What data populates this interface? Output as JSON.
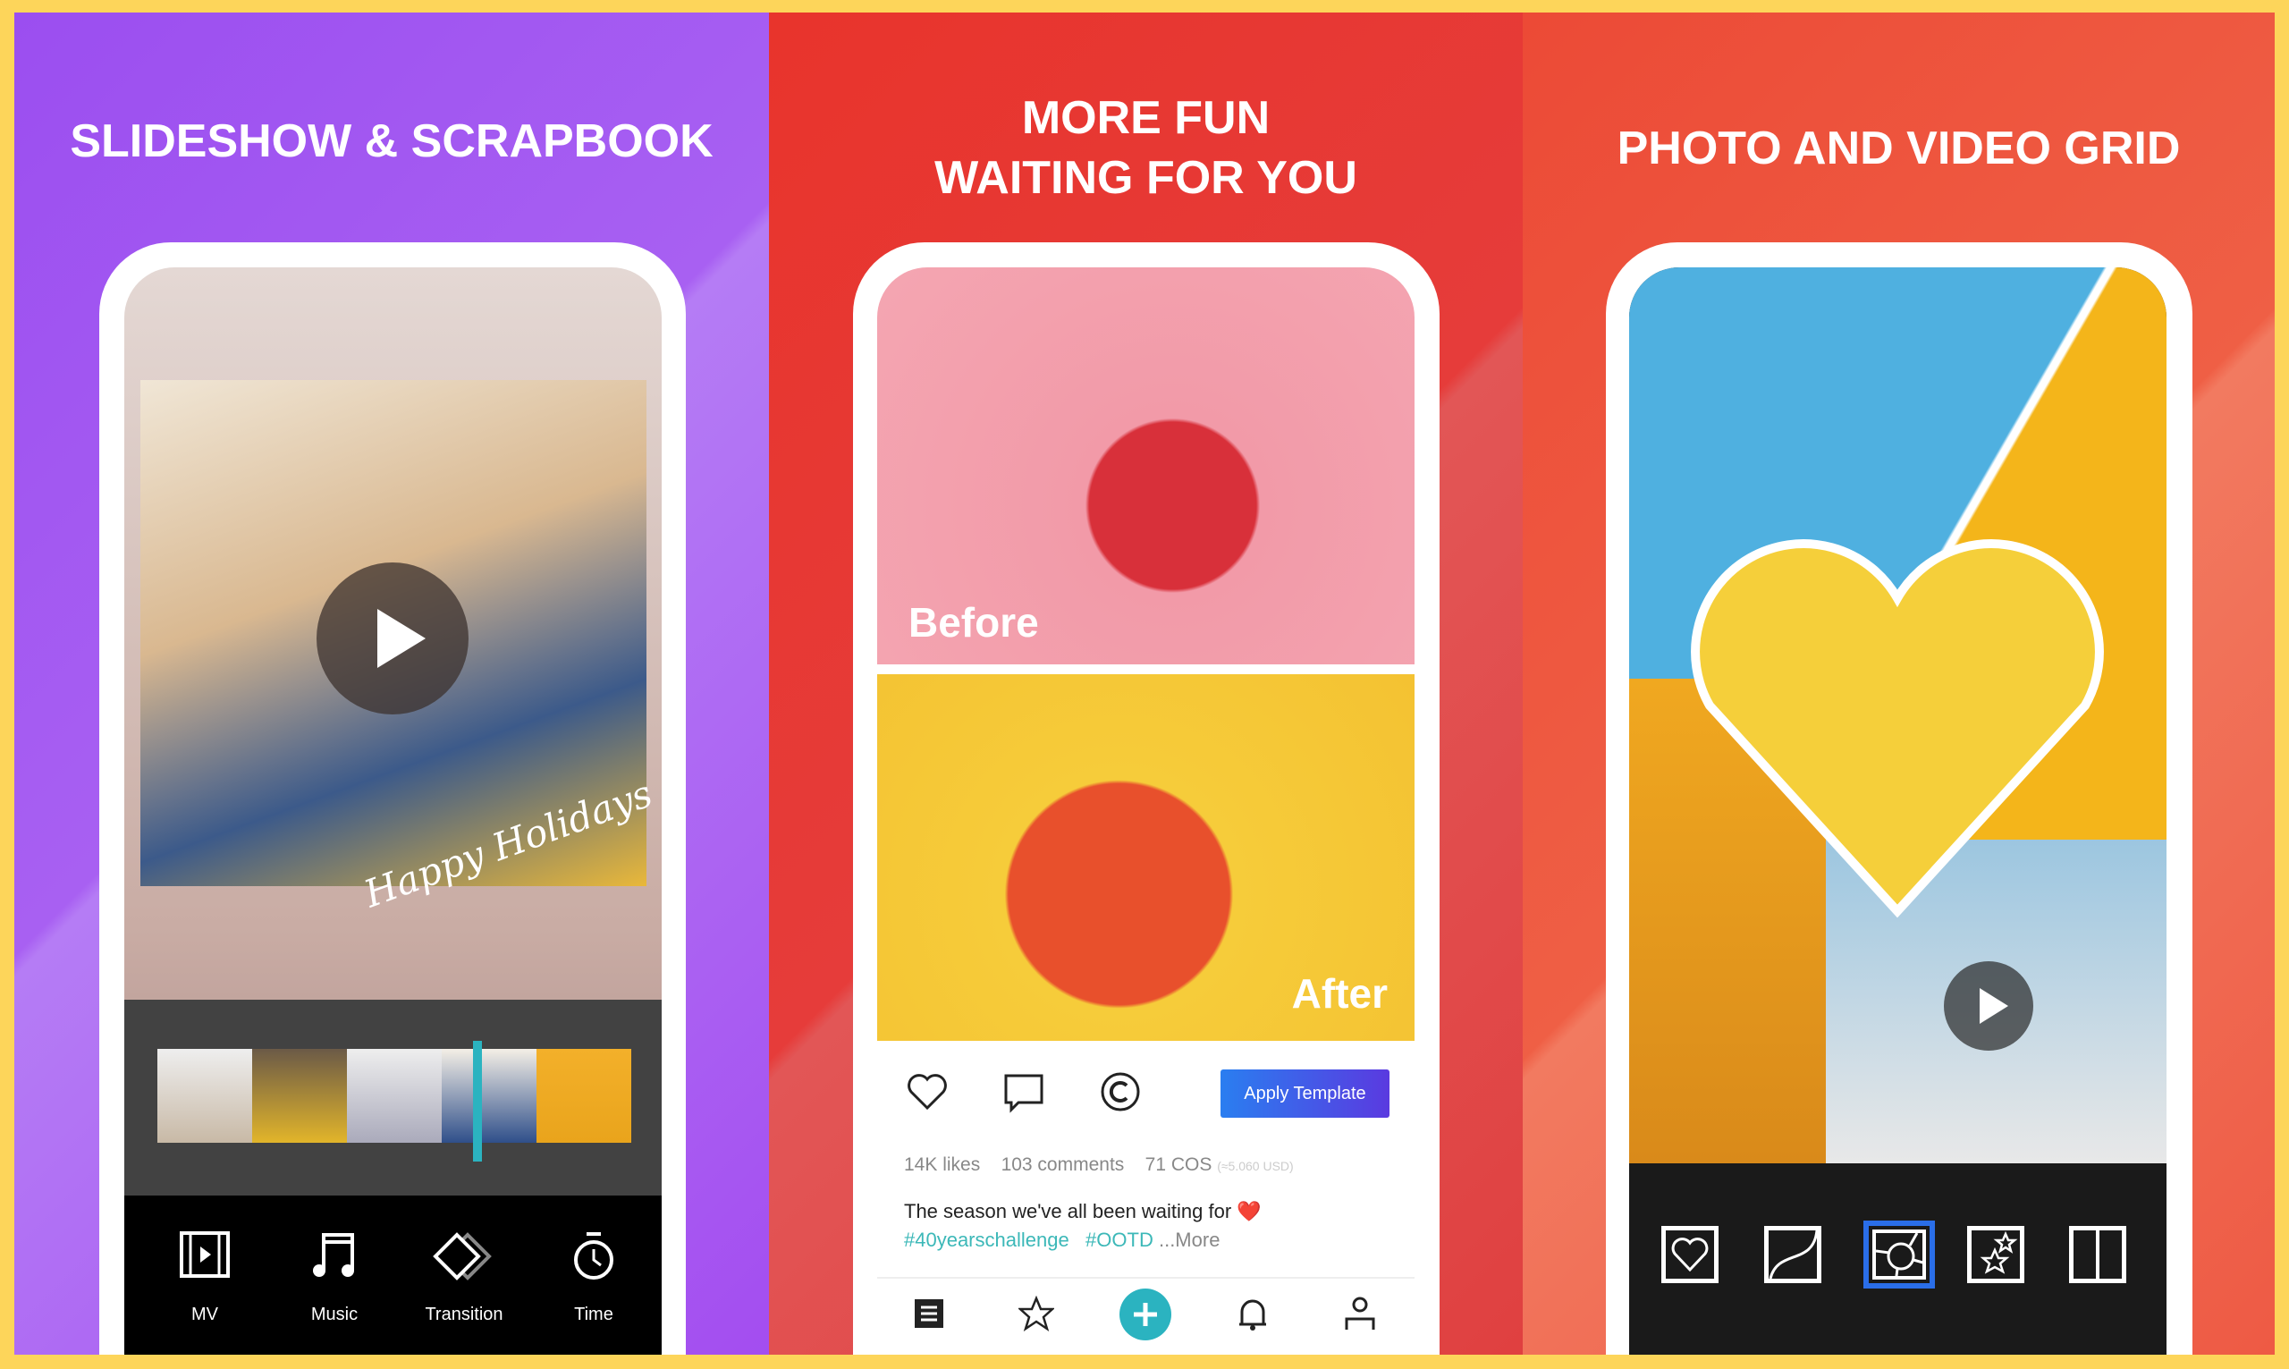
{
  "panels": [
    {
      "heading": "SLIDESHOW & SCRAPBOOK",
      "photo_caption": "Happy Holidays",
      "toolbar": [
        {
          "label": "MV",
          "icon": "film-play-icon"
        },
        {
          "label": "Music",
          "icon": "music-note-icon"
        },
        {
          "label": "Transition",
          "icon": "transition-icon"
        },
        {
          "label": "Time",
          "icon": "stopwatch-icon"
        }
      ]
    },
    {
      "heading_line1": "MORE FUN",
      "heading_line2": "WAITING FOR YOU",
      "before_label": "Before",
      "after_label": "After",
      "apply_button": "Apply Template",
      "likes": "14K likes",
      "comments": "103 comments",
      "cos": "71 COS",
      "cos_usd": "(≈5.060 USD)",
      "caption": "The season we've all been waiting for ❤️",
      "hashtag1": "#40yearschallenge",
      "hashtag2": "#OOTD",
      "more": "...More",
      "nav": [
        "feed-icon",
        "star-icon",
        "add-icon",
        "bell-icon",
        "profile-icon"
      ]
    },
    {
      "heading": "PHOTO AND VIDEO GRID",
      "grid_options": [
        "heart-frame-icon",
        "curve-frame-icon",
        "circle-frame-icon",
        "stars-frame-icon",
        "split-frame-icon"
      ],
      "selected_grid": 2
    }
  ],
  "colors": {
    "border": "#fdd55a",
    "accent_teal": "#2bb3c0",
    "selected_blue": "#2a6ee8"
  }
}
